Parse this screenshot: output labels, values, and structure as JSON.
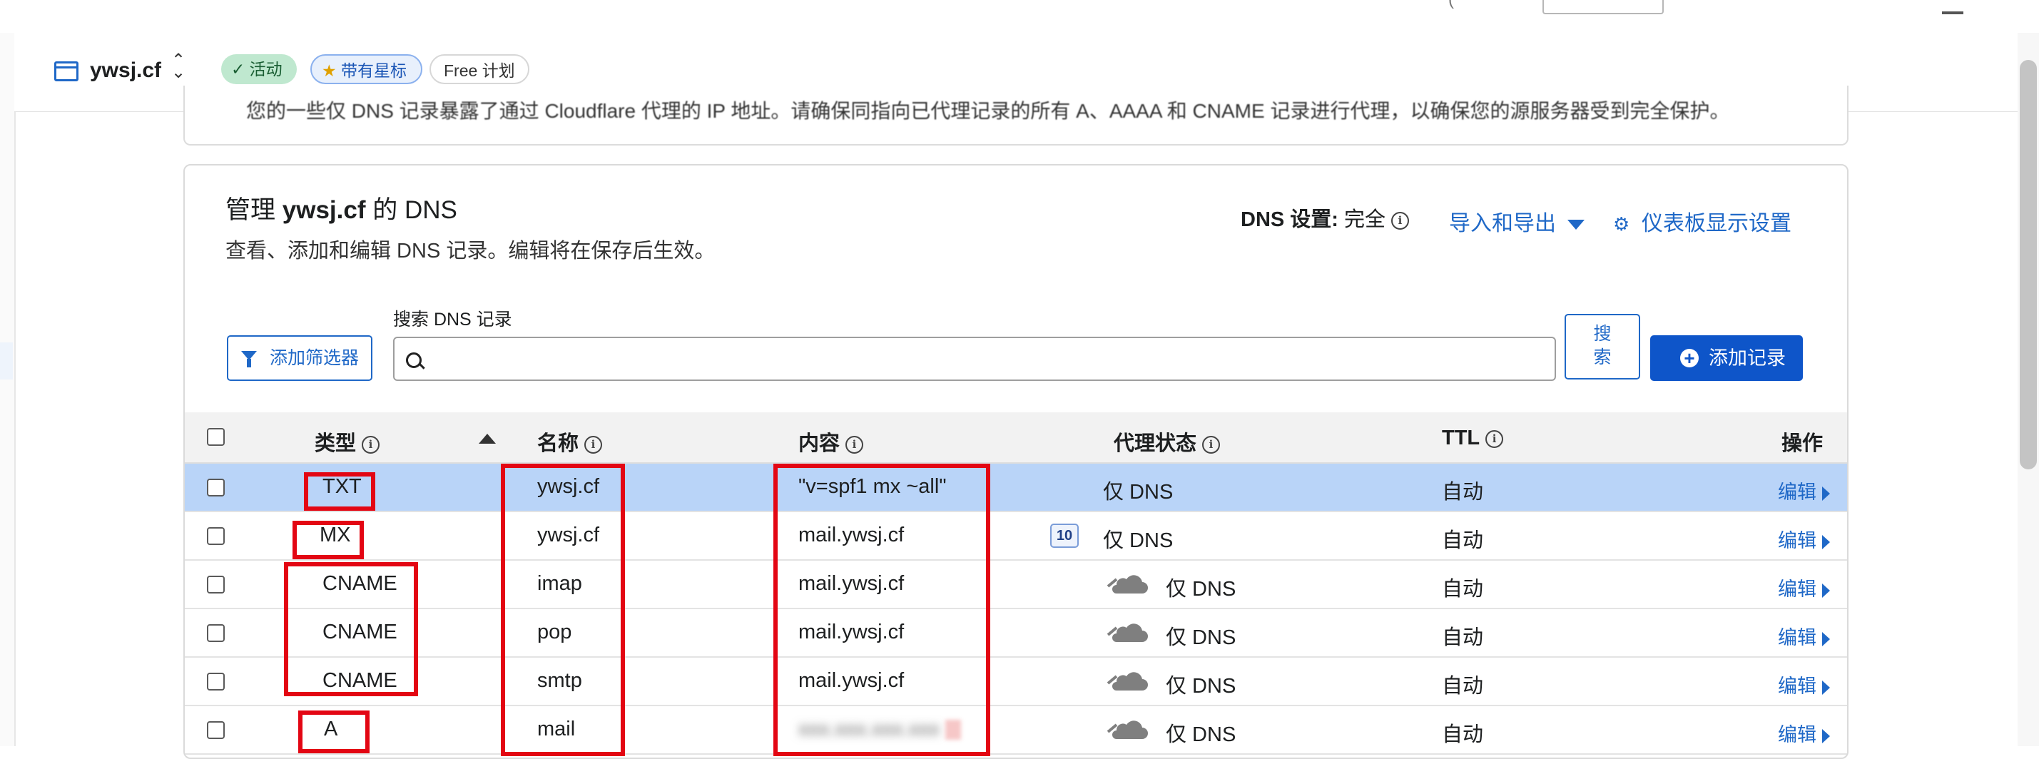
{
  "colors": {
    "accent": "#1f68c7",
    "primary_button": "#0e55c9",
    "annotation": "#e30613",
    "selected_row": "#b9d4f8"
  },
  "zone": {
    "name": "ywsj.cf",
    "switch_icon": "chevron-up-down-icon",
    "status": "活动",
    "starred": "带有星标",
    "plan": "Free 计划"
  },
  "prev_card": {
    "text": "您的一些仅 DNS 记录暴露了通过 Cloudflare 代理的 IP 地址。请确保同指向已代理记录的所有 A、AAAA 和 CNAME 记录进行代理，以确保您的源服务器受到完全保护。"
  },
  "dns_card": {
    "title_prefix": "管理",
    "title_domain": "ywsj.cf",
    "title_suffix": "的 DNS",
    "subtitle": "查看、添加和编辑 DNS 记录。编辑将在保存后生效。",
    "dns_setting_label": "DNS 设置:",
    "dns_setting_value": "完全",
    "import_export": "导入和导出",
    "dashboard_settings": "仪表板显示设置",
    "filter_button": "添加筛选器",
    "search_label": "搜索 DNS 记录",
    "search_placeholder": "",
    "search_button_line1": "搜",
    "search_button_line2": "索",
    "add_record_button": "添加记录"
  },
  "table": {
    "headers": {
      "type": "类型",
      "name": "名称",
      "content": "内容",
      "proxy": "代理状态",
      "ttl": "TTL",
      "actions": "操作"
    },
    "rows": [
      {
        "type": "TXT",
        "name": "ywsj.cf",
        "content": "\"v=spf1 mx ~all\"",
        "priority": "",
        "proxy": "仅 DNS",
        "ttl": "自动",
        "action": "编辑"
      },
      {
        "type": "MX",
        "name": "ywsj.cf",
        "content": "mail.ywsj.cf",
        "priority": "10",
        "proxy": "仅 DNS",
        "ttl": "自动",
        "action": "编辑"
      },
      {
        "type": "CNAME",
        "name": "imap",
        "content": "mail.ywsj.cf",
        "priority": "",
        "proxy": "仅 DNS",
        "ttl": "自动",
        "action": "编辑"
      },
      {
        "type": "CNAME",
        "name": "pop",
        "content": "mail.ywsj.cf",
        "priority": "",
        "proxy": "仅 DNS",
        "ttl": "自动",
        "action": "编辑"
      },
      {
        "type": "CNAME",
        "name": "smtp",
        "content": "mail.ywsj.cf",
        "priority": "",
        "proxy": "仅 DNS",
        "ttl": "自动",
        "action": "编辑"
      },
      {
        "type": "A",
        "name": "mail",
        "content": "xxx.xxx.xxx.xxx",
        "priority": "",
        "proxy": "仅 DNS",
        "ttl": "自动",
        "action": "编辑"
      }
    ]
  }
}
